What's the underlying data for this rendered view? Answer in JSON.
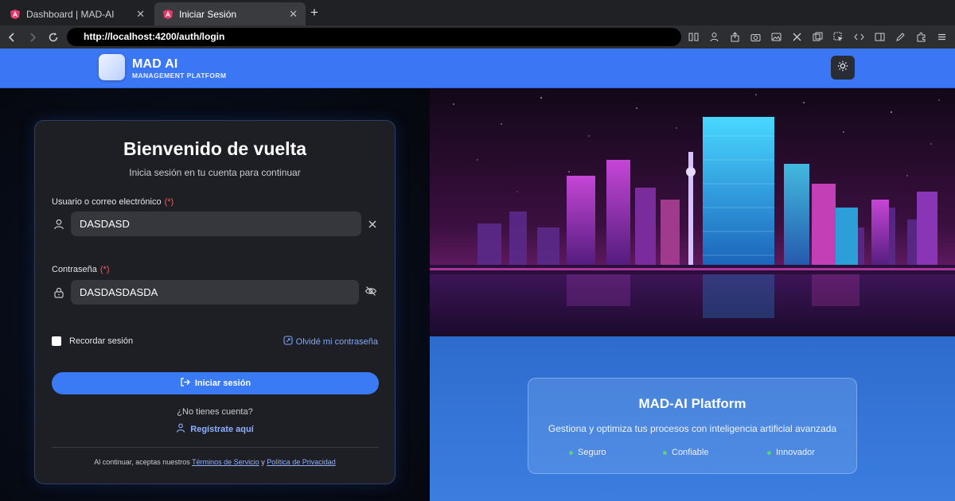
{
  "browser": {
    "tabs": [
      {
        "label": "Dashboard | MAD-AI",
        "active": false
      },
      {
        "label": "Iniciar Sesión",
        "active": true
      }
    ],
    "url": "http://localhost:4200/auth/login"
  },
  "header": {
    "brand": "MAD AI",
    "brand_sub": "MANAGEMENT PLATFORM"
  },
  "login": {
    "title": "Bienvenido de vuelta",
    "subtitle": "Inicia sesión en tu cuenta para continuar",
    "username_label": "Usuario o correo electrónico",
    "username_required": "(*)",
    "username_value": "DASDASD",
    "password_label": "Contraseña",
    "password_required": "(*)",
    "password_value": "DASDASDASDA",
    "remember_label": "Recordar sesión",
    "forgot_label": "Olvidé mi contraseña",
    "login_button": "Iniciar sesión",
    "no_account": "¿No tienes cuenta?",
    "register_label": "Regístrate aquí",
    "terms_prefix": "Al continuar, aceptas nuestros",
    "terms_link": "Términos de Servicio",
    "terms_and": "y",
    "privacy_link": "Política de Privacidad"
  },
  "promo": {
    "title": "MAD-AI Platform",
    "description": "Gestiona y optimiza tus procesos con inteligencia artificial avanzada",
    "features": [
      "Seguro",
      "Confiable",
      "Innovador"
    ]
  },
  "colors": {
    "header_blue": "#3b76f4",
    "button_blue": "#3a7bf5",
    "required_red": "#f25b5b",
    "feature_dot": "#5ad07a"
  }
}
